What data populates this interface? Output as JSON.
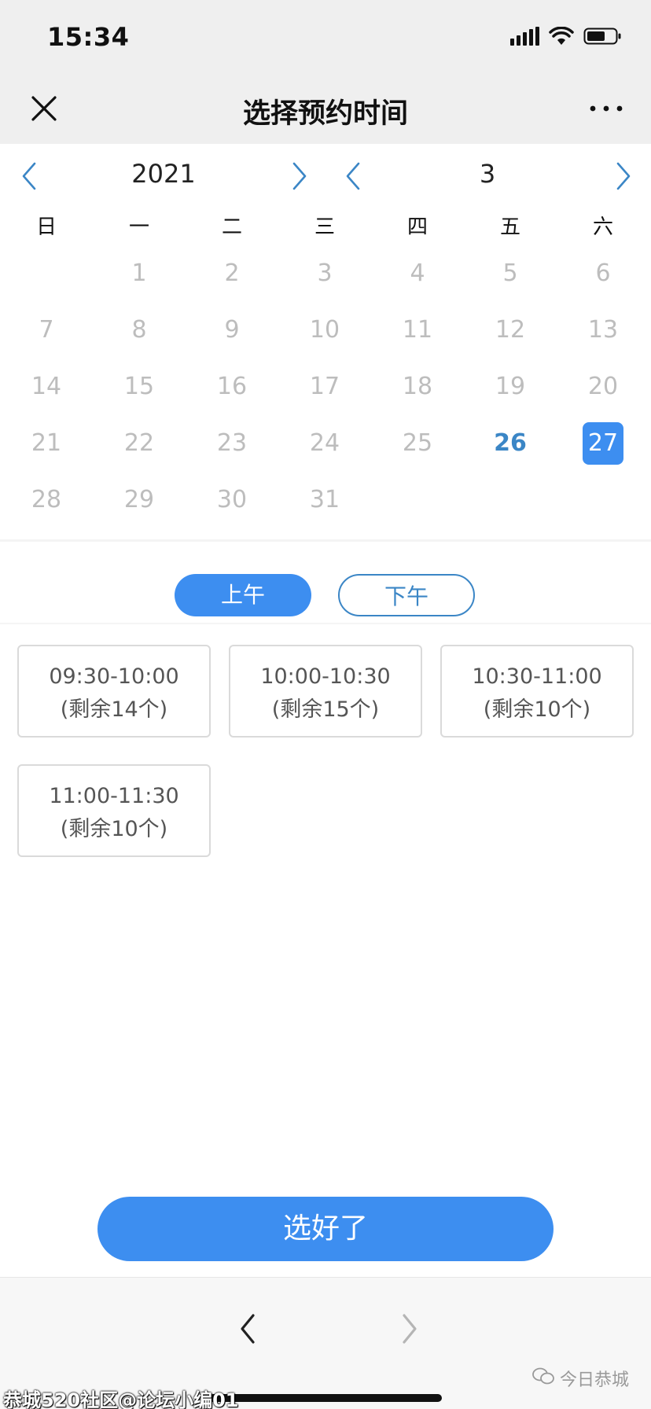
{
  "status_bar": {
    "time": "15:34"
  },
  "header": {
    "title": "选择预约时间"
  },
  "calendar": {
    "year": "2021",
    "month": "3",
    "weekdays": [
      "日",
      "一",
      "二",
      "三",
      "四",
      "五",
      "六"
    ],
    "days": [
      "1",
      "2",
      "3",
      "4",
      "5",
      "6",
      "7",
      "8",
      "9",
      "10",
      "11",
      "12",
      "13",
      "14",
      "15",
      "16",
      "17",
      "18",
      "19",
      "20",
      "21",
      "22",
      "23",
      "24",
      "25",
      "26",
      "27",
      "28",
      "29",
      "30",
      "31"
    ],
    "first_weekday_index": 1,
    "available_days": [
      "26"
    ],
    "selected_day": "27"
  },
  "period": {
    "am_label": "上午",
    "pm_label": "下午",
    "selected": "am"
  },
  "slots": [
    {
      "time": "09:30-10:00",
      "remaining": "(剩余14个)"
    },
    {
      "time": "10:00-10:30",
      "remaining": "(剩余15个)"
    },
    {
      "time": "10:30-11:00",
      "remaining": "(剩余10个)"
    },
    {
      "time": "11:00-11:30",
      "remaining": "(剩余10个)"
    }
  ],
  "confirm": {
    "label": "选好了"
  },
  "watermarks": {
    "left": "恭城520社区@论坛小编01",
    "right": "今日恭城"
  },
  "colors": {
    "accent": "#3d8ef0",
    "available_day": "#3b86c6",
    "disabled_day": "#bdbdbd"
  },
  "icons": {
    "close": "close-icon",
    "more": "more-icon",
    "prev": "chevron-left-icon",
    "next": "chevron-right-icon"
  }
}
